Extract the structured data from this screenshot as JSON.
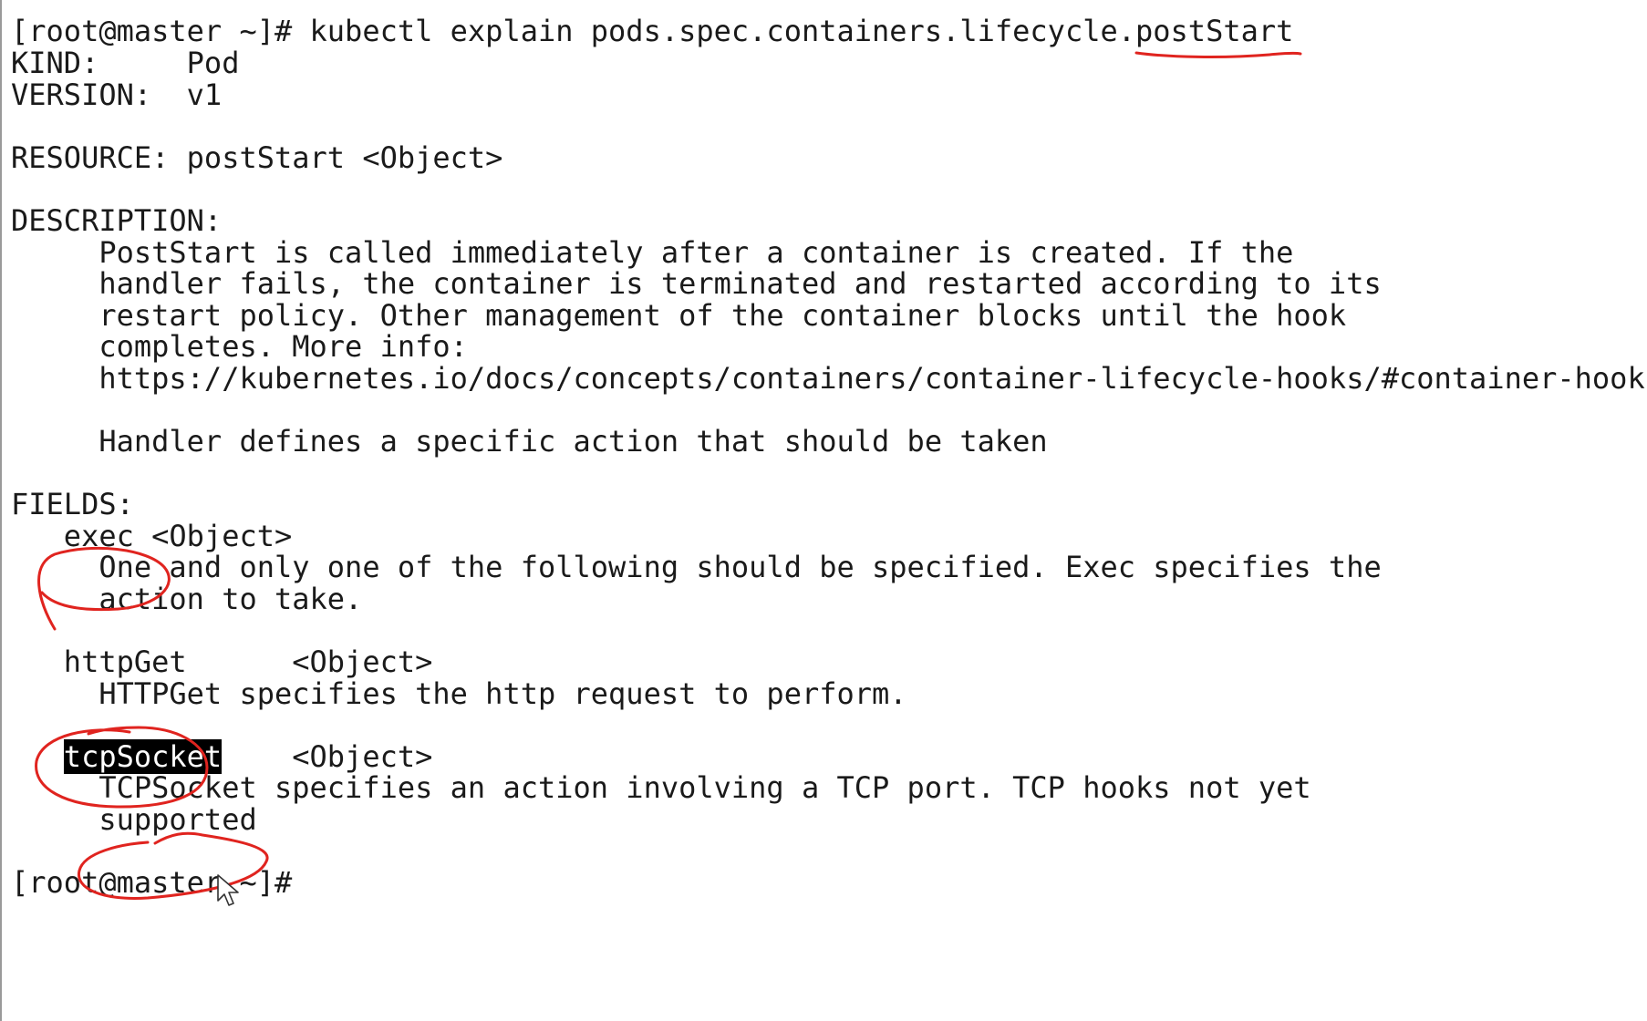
{
  "prompt": "[root@master ~]# ",
  "command": "kubectl explain pods.spec.containers.lifecycle.postStart",
  "kind_label": "KIND:",
  "kind_value": "Pod",
  "version_label": "VERSION:",
  "version_value": "v1",
  "resource_line": "RESOURCE: postStart <Object>",
  "description_header": "DESCRIPTION:",
  "description_lines": [
    "PostStart is called immediately after a container is created. If the",
    "handler fails, the container is terminated and restarted according to its",
    "restart policy. Other management of the container blocks until the hook",
    "completes. More info:",
    "https://kubernetes.io/docs/concepts/containers/container-lifecycle-hooks/#container-hooks"
  ],
  "handler_line": "Handler defines a specific action that should be taken",
  "fields_header": "FIELDS:",
  "fields": [
    {
      "name": "exec",
      "type": "<Object>",
      "description": [
        "One and only one of the following should be specified. Exec specifies the",
        "action to take."
      ]
    },
    {
      "name": "httpGet",
      "type": "<Object>",
      "description": [
        "HTTPGet specifies the http request to perform."
      ]
    },
    {
      "name": "tcpSocket",
      "type": "<Object>",
      "description": [
        "TCPSocket specifies an action involving a TCP port. TCP hooks not yet",
        "supported"
      ]
    }
  ],
  "final_prompt": "[root@master ~]#",
  "colors": {
    "background": "#ffffff",
    "text": "#1a1a1a",
    "annotation": "#e0241f",
    "selection_bg": "#000000",
    "selection_fg": "#ffffff"
  },
  "icons": {
    "cursor": "mouse-pointer-icon"
  }
}
